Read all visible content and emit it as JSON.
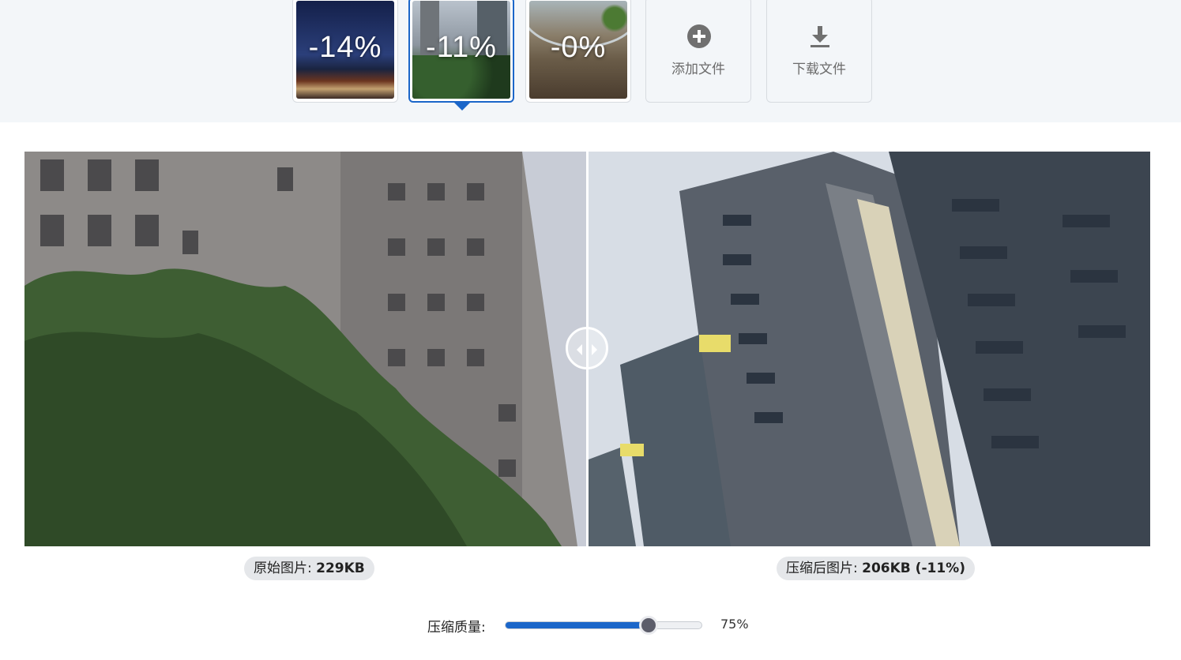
{
  "thumbnails": [
    {
      "name": "night-street",
      "reduction": "-14%",
      "selected": false
    },
    {
      "name": "apartment-buildings",
      "reduction": "-11%",
      "selected": true
    },
    {
      "name": "shopping-mall",
      "reduction": "-0%",
      "selected": false
    }
  ],
  "actions": {
    "add_label": "添加文件",
    "add_icon": "plus-circle-icon",
    "download_label": "下载文件",
    "download_icon": "download-icon"
  },
  "comparison": {
    "original_label": "原始图片:",
    "original_size": "229KB",
    "compressed_label": "压缩后图片:",
    "compressed_size": "206KB (-11%)"
  },
  "quality": {
    "label": "压缩质量:",
    "value": 75,
    "value_text": "75%"
  },
  "colors": {
    "accent": "#1b66c9",
    "slider_knob": "#5c5d6a",
    "top_background": "#f3f6f9"
  }
}
